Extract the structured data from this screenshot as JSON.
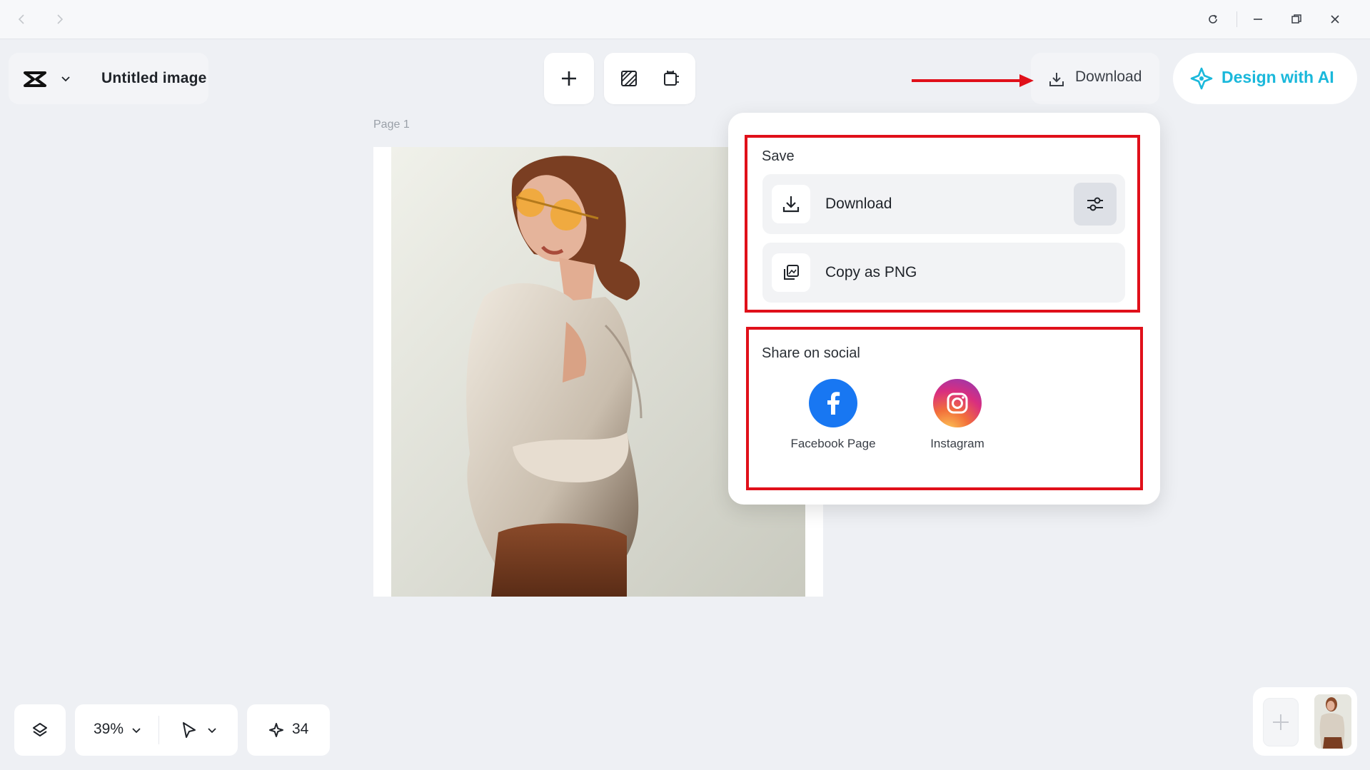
{
  "window": {
    "controls": [
      "back-icon",
      "forward-icon",
      "refresh-icon",
      "minimize-icon",
      "restore-icon",
      "close-icon"
    ]
  },
  "header": {
    "document_title": "Untitled image",
    "download_label": "Download",
    "design_ai_label": "Design with AI"
  },
  "canvas": {
    "page_label": "Page 1"
  },
  "export_menu": {
    "save_section": {
      "title": "Save",
      "download_label": "Download",
      "copy_label": "Copy as PNG"
    },
    "share_section": {
      "title": "Share on social",
      "items": [
        {
          "label": "Facebook Page",
          "icon": "facebook-icon",
          "color": "#1877f2"
        },
        {
          "label": "Instagram",
          "icon": "instagram-icon",
          "color": "#e1306c"
        }
      ]
    }
  },
  "bottom_toolbar": {
    "zoom": "39%",
    "credits": "34"
  },
  "colors": {
    "accent_ai": "#1ab8db",
    "annotation_red": "#e0101a",
    "background": "#eef0f4"
  }
}
